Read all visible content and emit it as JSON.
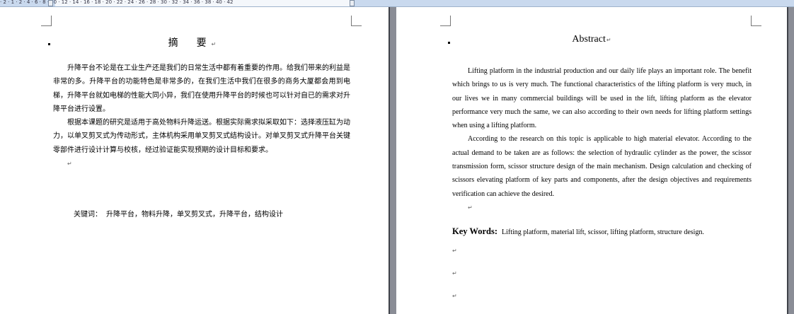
{
  "ruler": {
    "numbers": "· 2 · 1 · 2 · 4 · 6 · 8 · 10 · 12 · 14 · 16 · 18 · 20 · 22 · 24 · 26 · 28 · 30 · 32 · 34 · 36 · 38 · 40 · 42"
  },
  "left_page": {
    "title": "摘　要",
    "paragraph_mark": "↵",
    "paragraphs": [
      "升降平台不论是在工业生产还是我们的日常生活中都有着重要的作用。给我们带来的利益是非常的多。升降平台的功能特色是非常多的，在我们生活中我们在很多的商务大厦都会用到电梯，升降平台就如电梯的性能大同小异，我们在使用升降平台的时候也可以针对自已的需求对升降平台进行设置。",
      "根据本课题的研究是适用于高处物料升降运送。根据实际需求拟采取如下：选择液压缸为动力，以单叉剪叉式为传动形式，主体机构采用单叉剪叉式结构设计。对单叉剪叉式升降平台关键零部件进行设计计算与校核，经过验证能实现预期的设计目标和要求。"
    ],
    "keywords_label": "关键词：",
    "keywords_text": "升降平台，物料升降，单叉剪叉式，升降平台，结构设计"
  },
  "right_page": {
    "title": "Abstract",
    "paragraph_mark": "↵",
    "paragraphs": [
      "Lifting platform in the industrial production and our daily life plays an important role. The benefit which brings to us is very much. The functional characteristics of the lifting platform is very much, in our lives we in many commercial buildings will be used in the lift, lifting platform as the elevator performance very much the same, we can also according to their own needs for lifting platform settings when using a lifting platform.",
      "According to the research on this topic is applicable to high material elevator. According to the actual demand to be taken are as follows: the selection of hydraulic cylinder as the power, the scissor transmission form, scissor structure design of the main mechanism. Design calculation and checking of scissors elevating platform of key parts and components, after the design objectives and requirements verification can achieve the desired."
    ],
    "keywords_label": "Key Words:",
    "keywords_text": "Lifting platform, material lift, scissor, lifting platform, structure design."
  }
}
